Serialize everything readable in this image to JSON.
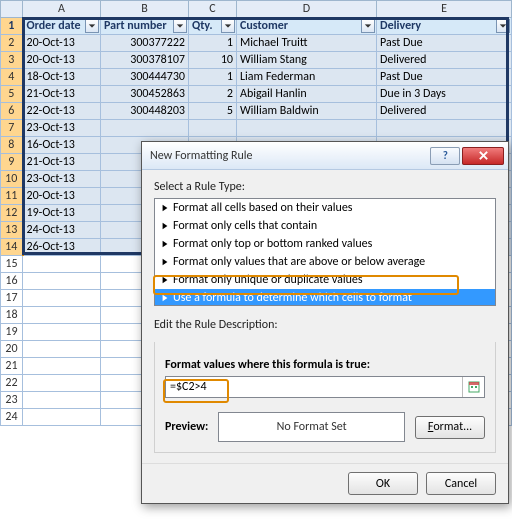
{
  "columns": [
    "",
    "A",
    "B",
    "C",
    "D",
    "E"
  ],
  "headers": {
    "A": "Order date",
    "B": "Part number",
    "C": "Qty.",
    "D": "Customer",
    "E": "Delivery"
  },
  "rows": [
    {
      "n": 1,
      "A": "Order date",
      "B": "Part number",
      "C": "Qty.",
      "D": "Customer",
      "E": "Delivery",
      "hdr": true
    },
    {
      "n": 2,
      "A": "20-Oct-13",
      "B": "300377222",
      "C": "1",
      "D": "Michael Truitt",
      "E": "Past Due"
    },
    {
      "n": 3,
      "A": "20-Oct-13",
      "B": "300378107",
      "C": "10",
      "D": "William Stang",
      "E": "Delivered"
    },
    {
      "n": 4,
      "A": "18-Oct-13",
      "B": "300444730",
      "C": "1",
      "D": "Liam Federman",
      "E": "Past Due"
    },
    {
      "n": 5,
      "A": "21-Oct-13",
      "B": "300452863",
      "C": "2",
      "D": "Abigail Hanlin",
      "E": "Due in 3 Days"
    },
    {
      "n": 6,
      "A": "22-Oct-13",
      "B": "300448203",
      "C": "5",
      "D": "William Baldwin",
      "E": "Delivered"
    },
    {
      "n": 7,
      "A": "23-Oct-13",
      "B": "",
      "C": "",
      "D": "",
      "E": ""
    },
    {
      "n": 8,
      "A": "16-Oct-13",
      "B": "",
      "C": "",
      "D": "",
      "E": ""
    },
    {
      "n": 9,
      "A": "21-Oct-13",
      "B": "",
      "C": "",
      "D": "",
      "E": ""
    },
    {
      "n": 10,
      "A": "23-Oct-13",
      "B": "",
      "C": "",
      "D": "",
      "E": ""
    },
    {
      "n": 11,
      "A": "20-Oct-13",
      "B": "",
      "C": "",
      "D": "",
      "E": ""
    },
    {
      "n": 12,
      "A": "19-Oct-13",
      "B": "",
      "C": "",
      "D": "",
      "E": ""
    },
    {
      "n": 13,
      "A": "24-Oct-13",
      "B": "",
      "C": "",
      "D": "",
      "E": ""
    },
    {
      "n": 14,
      "A": "26-Oct-13",
      "B": "",
      "C": "",
      "D": "",
      "E": ""
    },
    {
      "n": 15
    },
    {
      "n": 16
    },
    {
      "n": 17
    },
    {
      "n": 18
    },
    {
      "n": 19
    },
    {
      "n": 20
    },
    {
      "n": 21
    },
    {
      "n": 22
    },
    {
      "n": 23
    },
    {
      "n": 24
    }
  ],
  "dialog": {
    "title": "New Formatting Rule",
    "select_label": "Select a Rule Type:",
    "rule_types": [
      "Format all cells based on their values",
      "Format only cells that contain",
      "Format only top or bottom ranked values",
      "Format only values that are above or below average",
      "Format only unique or duplicate values",
      "Use a formula to determine which cells to format"
    ],
    "edit_label": "Edit the Rule Description:",
    "formula_label": "Format values where this formula is true:",
    "formula_value": "=$C2>4",
    "preview_label": "Preview:",
    "preview_text": "No Format Set",
    "format_btn": "Format...",
    "ok": "OK",
    "cancel": "Cancel"
  }
}
